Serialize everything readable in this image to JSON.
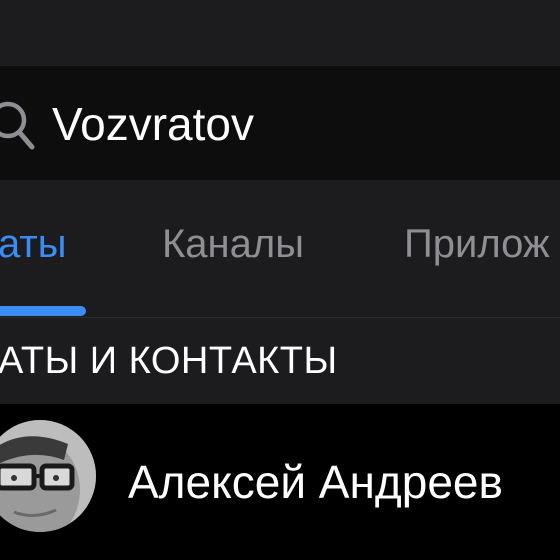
{
  "search": {
    "value": "Vozvratov"
  },
  "tabs": [
    {
      "label": "аты",
      "active": true
    },
    {
      "label": "Каналы",
      "active": false
    },
    {
      "label": "Прилож",
      "active": false
    }
  ],
  "section": {
    "title": "АТЫ И КОНТАКТЫ"
  },
  "results": [
    {
      "name": "Алексей Андреев"
    }
  ],
  "colors": {
    "accent": "#3b8cf5",
    "inactive_tab": "#8e8e93",
    "panel": "#1c1c1e",
    "background": "#000000"
  },
  "icons": {
    "search": "search-icon"
  }
}
